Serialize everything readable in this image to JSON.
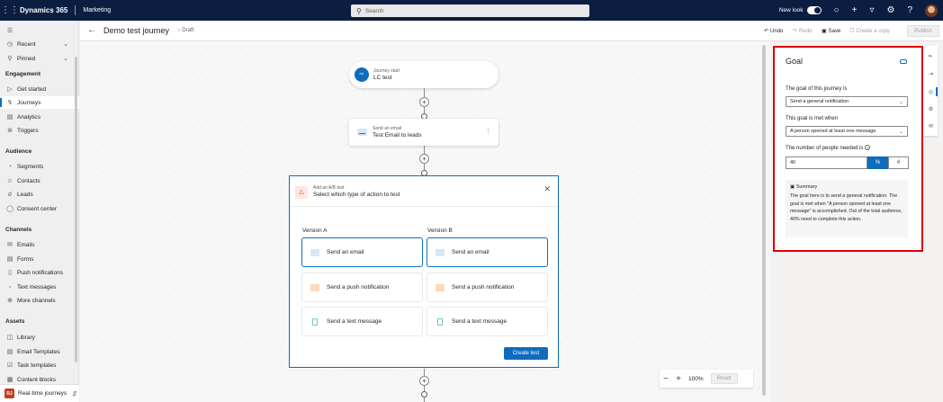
{
  "topbar": {
    "brand": "Dynamics 365",
    "app": "Marketing",
    "search_placeholder": "Search",
    "new_look_label": "New look"
  },
  "sidebar": {
    "items_top": [
      {
        "label": "Recent",
        "icon": "clock-icon"
      },
      {
        "label": "Pinned",
        "icon": "pin-icon"
      }
    ],
    "groups": [
      {
        "title": "Engagement",
        "items": [
          "Get started",
          "Journeys",
          "Analytics",
          "Triggers"
        ]
      },
      {
        "title": "Audience",
        "items": [
          "Segments",
          "Contacts",
          "Leads",
          "Consent center"
        ]
      },
      {
        "title": "Channels",
        "items": [
          "Emails",
          "Forms",
          "Push notifications",
          "Text messages",
          "More channels"
        ]
      },
      {
        "title": "Assets",
        "items": [
          "Library",
          "Email Templates",
          "Task templates",
          "Content blocks"
        ]
      }
    ],
    "active_item": "Journeys",
    "area_badge": "RJ",
    "area_label": "Real-time journeys"
  },
  "command_bar": {
    "title": "Demo test journey",
    "status": "Draft",
    "undo": "Undo",
    "redo": "Redo",
    "save": "Save",
    "save_copy": "Create a copy",
    "publish": "Publish"
  },
  "canvas": {
    "start_card": {
      "subtitle": "Journey start",
      "title": "LC test"
    },
    "email_card": {
      "subtitle": "Send an email",
      "title": "Test Email to leads"
    },
    "ab_test": {
      "subtitle": "Add an A/B test",
      "title": "Select which type of action to test",
      "version_a": "Version A",
      "version_b": "Version B",
      "options": [
        "Send an email",
        "Send a push notification",
        "Send a text message"
      ],
      "create_button": "Create test"
    },
    "zoom": {
      "level": "100%",
      "reset": "Reset"
    }
  },
  "goal_panel": {
    "title": "Goal",
    "goal_label": "The goal of this journey is",
    "goal_value": "Send a general notification",
    "met_label": "This goal is met when",
    "met_value": "A person opened at least one message",
    "needed_label": "The number of people needed is",
    "needed_value": "40",
    "percent_label": "%",
    "count_label": "#",
    "summary_title": "Summary",
    "summary_text": "The goal here is to send a general notification. The goal is met when \"A person opened at least one message\" is accomplished. Out of the total audience, 40% need to complete this action."
  },
  "colors": {
    "topbar": "#0b1d41",
    "accent": "#0f6cbd",
    "highlight_border": "#e00000"
  }
}
